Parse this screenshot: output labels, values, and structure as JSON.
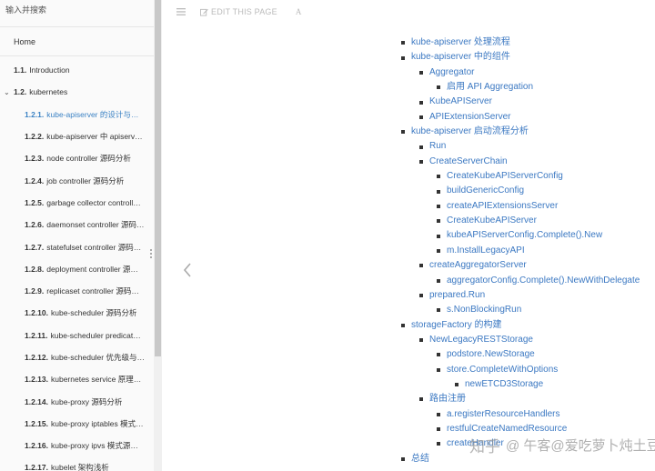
{
  "sidebar": {
    "search_placeholder": "输入并搜索",
    "home": "Home",
    "items": [
      {
        "num": "1.1.",
        "label": "Introduction",
        "level": 1
      },
      {
        "num": "1.2.",
        "label": "kubernetes",
        "level": 1,
        "expanded": true
      },
      {
        "num": "1.2.1.",
        "label": "kube-apiserver 的设计与实现",
        "level": 2,
        "active": true
      },
      {
        "num": "1.2.2.",
        "label": "kube-apiserver 中 apiserver service 的实现",
        "level": 2
      },
      {
        "num": "1.2.3.",
        "label": "node controller 源码分析",
        "level": 2
      },
      {
        "num": "1.2.4.",
        "label": "job controller 源码分析",
        "level": 2
      },
      {
        "num": "1.2.5.",
        "label": "garbage collector controller 源码分析",
        "level": 2
      },
      {
        "num": "1.2.6.",
        "label": "daemonset controller 源码分析",
        "level": 2
      },
      {
        "num": "1.2.7.",
        "label": "statefulset controller 源码分析",
        "level": 2
      },
      {
        "num": "1.2.8.",
        "label": "deployment controller 源码分析",
        "level": 2
      },
      {
        "num": "1.2.9.",
        "label": "replicaset controller 源码分析",
        "level": 2
      },
      {
        "num": "1.2.10.",
        "label": "kube-scheduler 源码分析",
        "level": 2
      },
      {
        "num": "1.2.11.",
        "label": "kube-scheduler predicates 调度算法源码分析",
        "level": 2
      },
      {
        "num": "1.2.12.",
        "label": "kube-scheduler 优先级与抢占机制源码分析",
        "level": 2
      },
      {
        "num": "1.2.13.",
        "label": "kubernetes service 原理解析",
        "level": 2
      },
      {
        "num": "1.2.14.",
        "label": "kube-proxy 源码分析",
        "level": 2
      },
      {
        "num": "1.2.15.",
        "label": "kube-proxy iptables 模式源码分析",
        "level": 2
      },
      {
        "num": "1.2.16.",
        "label": "kube-proxy ipvs 模式源码分析",
        "level": 2
      },
      {
        "num": "1.2.17.",
        "label": "kubelet 架构浅析",
        "level": 2
      }
    ]
  },
  "toolbar": {
    "menu_icon": "hamburger-icon",
    "edit_label": "EDIT THIS PAGE",
    "font_label": "A"
  },
  "toc": [
    {
      "text": "kube-apiserver 处理流程",
      "level": 1
    },
    {
      "text": "kube-apiserver 中的组件",
      "level": 1
    },
    {
      "text": "Aggregator",
      "level": 2
    },
    {
      "text": "启用 API Aggregation",
      "level": 3
    },
    {
      "text": "KubeAPIServer",
      "level": 2
    },
    {
      "text": "APIExtensionServer",
      "level": 2
    },
    {
      "text": "kube-apiserver 启动流程分析",
      "level": 1
    },
    {
      "text": "Run",
      "level": 2
    },
    {
      "text": "CreateServerChain",
      "level": 2
    },
    {
      "text": "CreateKubeAPIServerConfig",
      "level": 3
    },
    {
      "text": "buildGenericConfig",
      "level": 3
    },
    {
      "text": "createAPIExtensionsServer",
      "level": 3
    },
    {
      "text": "CreateKubeAPIServer",
      "level": 3
    },
    {
      "text": "kubeAPIServerConfig.Complete().New",
      "level": 3
    },
    {
      "text": "m.InstallLegacyAPI",
      "level": 3
    },
    {
      "text": "createAggregatorServer",
      "level": 2
    },
    {
      "text": "aggregatorConfig.Complete().NewWithDelegate",
      "level": 3
    },
    {
      "text": "prepared.Run",
      "level": 2
    },
    {
      "text": "s.NonBlockingRun",
      "level": 3
    },
    {
      "text": "storageFactory 的构建",
      "level": 1
    },
    {
      "text": "NewLegacyRESTStorage",
      "level": 2
    },
    {
      "text": "podstore.NewStorage",
      "level": 3
    },
    {
      "text": "store.CompleteWithOptions",
      "level": 3
    },
    {
      "text": "newETCD3Storage",
      "level": 4
    },
    {
      "text": "路由注册",
      "level": 2
    },
    {
      "text": "a.registerResourceHandlers",
      "level": 3
    },
    {
      "text": "restfulCreateNamedResource",
      "level": 3
    },
    {
      "text": "createHandler",
      "level": 3
    },
    {
      "text": "总结",
      "level": 1
    }
  ],
  "watermark": {
    "logo": "知乎",
    "user": "@ 午客@爱吃萝卜炖土豆"
  },
  "colors": {
    "link": "#3b78c2",
    "active": "#3b82c4",
    "sidebar_bg": "#fafafa"
  }
}
